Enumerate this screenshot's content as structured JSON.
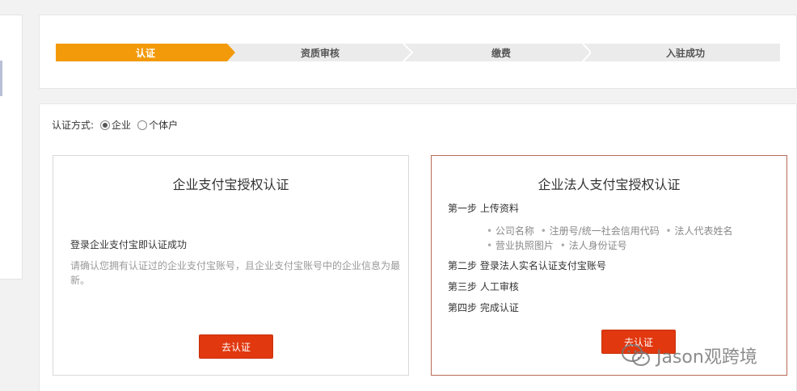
{
  "steps": [
    {
      "label": "认证",
      "active": true
    },
    {
      "label": "资质审核",
      "active": false
    },
    {
      "label": "缴费",
      "active": false
    },
    {
      "label": "入驻成功",
      "active": false
    }
  ],
  "colors": {
    "active_step": "#f39a0b",
    "inactive_step": "#ebebeb",
    "primary_button": "#e1380f",
    "selected_border": "#b86a55"
  },
  "auth": {
    "label": "认证方式:",
    "options": [
      {
        "label": "企业",
        "selected": true
      },
      {
        "label": "个体户",
        "selected": false
      }
    ]
  },
  "enterprise": {
    "title": "企业支付宝授权认证",
    "subtitle": "登录企业支付宝即认证成功",
    "description": "请确认您拥有认证过的企业支付宝账号，且企业支付宝账号中的企业信息为最新。",
    "button": "去认证"
  },
  "legal": {
    "title": "企业法人支付宝授权认证",
    "step1": "第一步 上传资料",
    "items": [
      "公司名称",
      "注册号/统一社会信用代码",
      "法人代表姓名",
      "营业执照图片",
      "法人身份证号"
    ],
    "step2": "第二步 登录法人实名认证支付宝账号",
    "step3": "第三步 人工审核",
    "step4": "第四步 完成认证",
    "button": "去认证"
  },
  "watermark": {
    "text": "Jason观跨境",
    "icon": "wechat-icon"
  }
}
